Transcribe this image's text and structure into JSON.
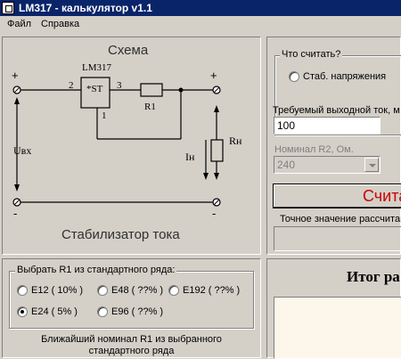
{
  "window": {
    "title": "LM317 - калькулятор v1.1"
  },
  "menu": {
    "items": [
      "Файл",
      "Справка"
    ]
  },
  "schema": {
    "title": "Схема",
    "chip": "LM317",
    "chip_inner": "*ST",
    "pins": [
      "2",
      "3",
      "1"
    ],
    "r1": "R1",
    "rn": "Rн",
    "in_label": "Uвх",
    "i_label": "Iн",
    "plus": "+",
    "minus": "-",
    "caption": "Стабилизатор тока"
  },
  "calc": {
    "group_title": "Что считать?",
    "mode_label": "Стаб. напряжения",
    "current_label": "Требуемый выходной ток, м",
    "current_value": "100",
    "r2_label": "Номинал R2, Ом.",
    "r2_value": "240",
    "button_label": "Счита",
    "exact_label": "Точное значение рассчитан",
    "exact_value": ""
  },
  "r1_series": {
    "group_title": "Выбрать R1 из стандартного ряда:",
    "options": [
      {
        "label": "E12 ( 10% )",
        "selected": false
      },
      {
        "label": "E48 ( ??% )",
        "selected": false
      },
      {
        "label": "E192 ( ??% )",
        "selected": false
      },
      {
        "label": "E24 ( 5% )",
        "selected": true
      },
      {
        "label": "E96 ( ??% )",
        "selected": false
      }
    ],
    "nearest_label_line1": "Ближайший номинал R1 из выбранного",
    "nearest_label_line2": "стандартного ряда"
  },
  "result": {
    "title": "Итог ра"
  },
  "colors": {
    "titlebar": "#0a246a",
    "face": "#d4d0c8",
    "calc_text": "#cc0000",
    "result_bg": "#fdf6ea"
  }
}
